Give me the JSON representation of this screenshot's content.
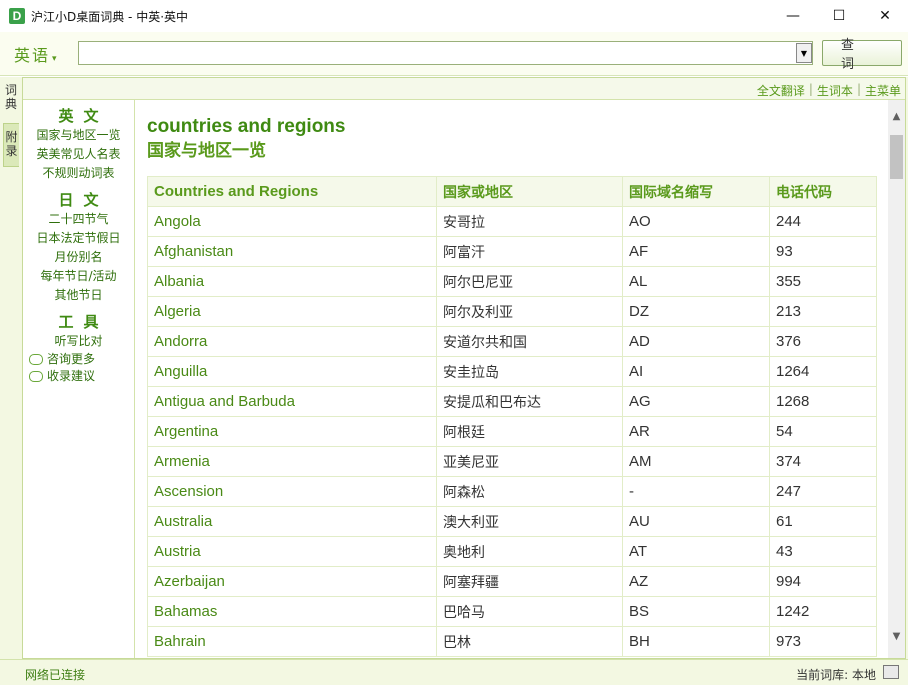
{
  "window": {
    "title": "沪江小D桌面词典 - 中英·英中",
    "icon_letter": "D",
    "minimize": "—",
    "maximize": "☐",
    "close": "✕"
  },
  "search": {
    "language": "英语",
    "language_arrow": "▾",
    "input_value": "",
    "dropdown_arrow": "▼",
    "query_button": "查词"
  },
  "side_tabs": [
    "词典",
    "附录"
  ],
  "top_links": [
    "全文翻译",
    "生词本",
    "主菜单"
  ],
  "left_nav": {
    "sections": [
      {
        "heading": "英文",
        "items": [
          "国家与地区一览",
          "英美常见人名表",
          "不规则动词表"
        ]
      },
      {
        "heading": "日文",
        "items": [
          "二十四节气",
          "日本法定节假日",
          "月份别名",
          "每年节日/活动",
          "其他节日"
        ]
      },
      {
        "heading": "工具",
        "items": [
          "听写比对"
        ]
      }
    ],
    "icon_items": [
      {
        "icon": "chat-bubble-icon",
        "label": "咨询更多"
      },
      {
        "icon": "chat-bubble-icon",
        "label": "收录建议"
      }
    ]
  },
  "article": {
    "title": "countries and regions",
    "subtitle": "国家与地区一览",
    "headers": [
      "Countries and Regions",
      "国家或地区",
      "国际域名缩写",
      "电话代码"
    ],
    "rows": [
      [
        "Angola",
        "安哥拉",
        "AO",
        "244"
      ],
      [
        "Afghanistan",
        "阿富汗",
        "AF",
        "93"
      ],
      [
        "Albania",
        "阿尔巴尼亚",
        "AL",
        "355"
      ],
      [
        "Algeria",
        "阿尔及利亚",
        "DZ",
        "213"
      ],
      [
        "Andorra",
        "安道尔共和国",
        "AD",
        "376"
      ],
      [
        "Anguilla",
        "安圭拉岛",
        "AI",
        "1264"
      ],
      [
        "Antigua and Barbuda",
        "安提瓜和巴布达",
        "AG",
        "1268"
      ],
      [
        "Argentina",
        "阿根廷",
        "AR",
        "54"
      ],
      [
        "Armenia",
        "亚美尼亚",
        "AM",
        "374"
      ],
      [
        "Ascension",
        "阿森松",
        "-",
        "247"
      ],
      [
        "Australia",
        "澳大利亚",
        "AU",
        "61"
      ],
      [
        "Austria",
        "奥地利",
        "AT",
        "43"
      ],
      [
        "Azerbaijan",
        "阿塞拜疆",
        "AZ",
        "994"
      ],
      [
        "Bahamas",
        "巴哈马",
        "BS",
        "1242"
      ],
      [
        "Bahrain",
        "巴林",
        "BH",
        "973"
      ]
    ]
  },
  "scrollbar": {
    "up": "▲",
    "down": "▼"
  },
  "status": {
    "left": "网络已连接",
    "right": "当前词库: 本地"
  },
  "colors": {
    "accent_green": "#5a9a1c",
    "link_green": "#2f6f0c",
    "frame_bg": "#f3f8e2"
  }
}
